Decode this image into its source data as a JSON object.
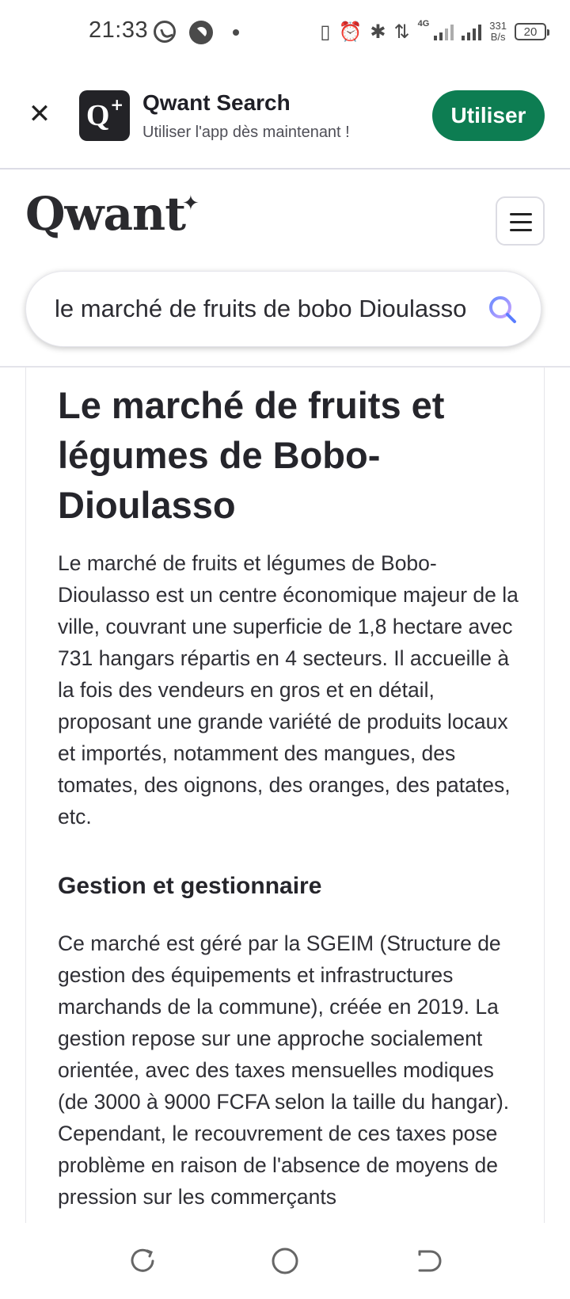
{
  "status_bar": {
    "time": "21:33",
    "network": "4G",
    "speed_value": "331",
    "speed_unit": "B/s",
    "battery": "20"
  },
  "banner": {
    "app_icon_letter": "Q",
    "app_icon_star": "+",
    "app_name": "Qwant Search",
    "subtitle": "Utiliser l'app dès maintenant !",
    "use_button": "Utiliser"
  },
  "header": {
    "logo": "Qwant",
    "search_query": "le marché de fruits de bobo Dioulasso"
  },
  "article": {
    "title": "Le marché de fruits et légumes de Bobo-Dioulasso",
    "paragraph1": "Le marché de fruits et légumes de Bobo-Dioulasso est un centre économique majeur de la ville, couvrant une superficie de 1,8 hectare avec 731 hangars répartis en 4 secteurs. Il accueille à la fois des vendeurs en gros et en détail, proposant une grande variété de produits locaux et importés, notamment des mangues, des tomates, des oignons, des oranges, des patates, etc.",
    "section_heading": "Gestion et gestionnaire",
    "paragraph2": "Ce marché est géré par la SGEIM (Structure de gestion des équipements et infrastructures marchands de la commune), créée en 2019. La gestion repose sur une approche socialement orientée, avec des taxes mensuelles modiques (de 3000 à 9000 FCFA selon la taille du hangar). Cependant, le recouvrement de ces taxes pose problème en raison de l'absence de moyens de pression sur les commerçants"
  },
  "colors": {
    "accent_green": "#0d7d52",
    "search_icon_gradient": [
      "#6b8cff",
      "#c9a2ff"
    ]
  },
  "icons": [
    "whatsapp-icon",
    "notification-icon",
    "vibrate-icon",
    "alarm-icon",
    "bluetooth-icon",
    "data-arrows-icon",
    "signal-icon",
    "battery-icon",
    "close-icon",
    "search-icon",
    "menu-icon",
    "recent-apps-icon",
    "home-icon",
    "back-icon"
  ]
}
